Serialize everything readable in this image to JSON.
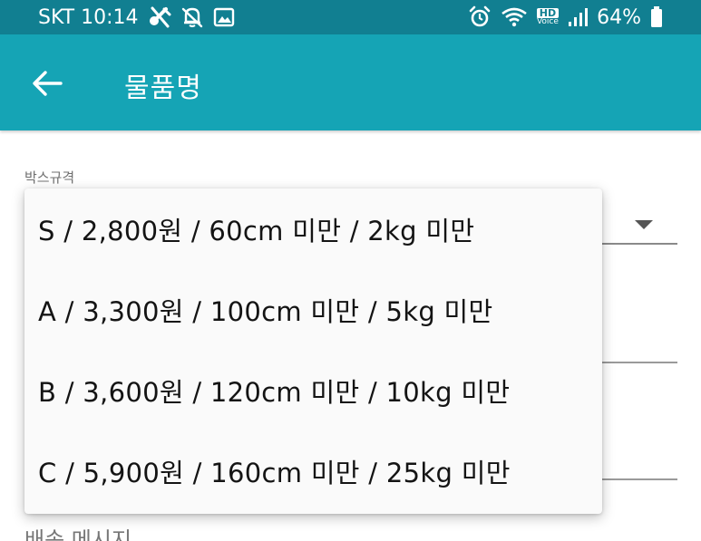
{
  "status_bar": {
    "carrier_time": "SKT 10:14",
    "battery": "64%",
    "hd_label": "HD",
    "voice_label": "Voice",
    "color": "#117f91"
  },
  "app_bar": {
    "title": "물품명",
    "back_icon": "arrow-left-icon",
    "color": "#15a4b5"
  },
  "form": {
    "box_spec_label": "박스규격",
    "delivery_message_label": "배송 메시지"
  },
  "dropdown": {
    "options": [
      "S / 2,800원 / 60cm 미만 / 2kg 미만",
      "A / 3,300원 / 100cm 미만 / 5kg 미만",
      "B / 3,600원 / 120cm 미만 / 10kg 미만",
      "C / 5,900원 / 160cm 미만 / 25kg 미만"
    ]
  }
}
